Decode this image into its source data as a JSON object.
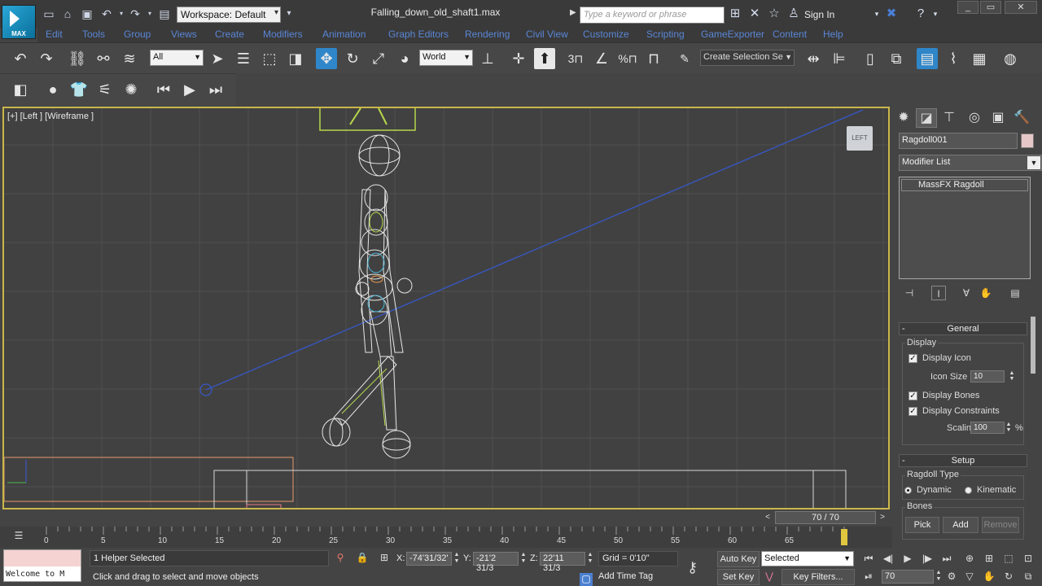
{
  "titlebar": {
    "logo_text": "MAX",
    "workspace": "Workspace: Default",
    "file_title": "Falling_down_old_shaft1.max",
    "search_placeholder": "Type a keyword or phrase",
    "sign_in": "Sign In"
  },
  "menu": [
    "Edit",
    "Tools",
    "Group",
    "Views",
    "Create",
    "Modifiers",
    "Animation",
    "Graph Editors",
    "Rendering",
    "Civil View",
    "Customize",
    "Scripting",
    "GameExporter",
    "Content",
    "Help"
  ],
  "toolbar": {
    "selection_filter": "All",
    "ref_coord_system": "World",
    "create_selection_set": "Create Selection Se"
  },
  "viewport": {
    "label": "[+] [Left ] [Wireframe ]",
    "viewcube_label": "LEFT"
  },
  "command_panel": {
    "object_name": "Ragdoll001",
    "modifier_list": "Modifier List",
    "modifier_item": "MassFX Ragdoll",
    "general": {
      "title": "General",
      "display_group": "Display",
      "display_icon": "Display Icon",
      "icon_size_label": "Icon Size",
      "icon_size": "10",
      "display_bones": "Display Bones",
      "display_constraints": "Display Constraints",
      "scaling_label": "Scaling",
      "scaling": "100",
      "percent": "%"
    },
    "setup": {
      "title": "Setup",
      "ragdoll_type": "Ragdoll Type",
      "dynamic": "Dynamic",
      "kinematic": "Kinematic",
      "bones": "Bones",
      "pick": "Pick",
      "add": "Add",
      "remove": "Remove"
    }
  },
  "timeline": {
    "slider": "70 / 70",
    "current_frame": 70,
    "total_frames": 70,
    "tick_labels": [
      "0",
      "5",
      "10",
      "15",
      "20",
      "25",
      "30",
      "35",
      "40",
      "45",
      "50",
      "55",
      "60",
      "65"
    ]
  },
  "status": {
    "maxscript_text": "Welcome to M",
    "selection": "1 Helper Selected",
    "prompt": "Click and drag to select and move objects",
    "x_label": "X:",
    "x_value": "-74'31/32'",
    "y_label": "Y:",
    "y_value": "-21'2 31/3",
    "z_label": "Z:",
    "z_value": "22'11 31/3",
    "grid": "Grid = 0'10\"",
    "add_time_tag": "Add Time Tag",
    "auto_key": "Auto Key",
    "set_key": "Set Key",
    "selected": "Selected",
    "key_filters": "Key Filters...",
    "frame": "70"
  },
  "colors": {
    "accent": "#2f86c9",
    "viewport_border": "#c9b74a",
    "menu_text": "#5a86d6",
    "time_marker": "#e1c640"
  }
}
